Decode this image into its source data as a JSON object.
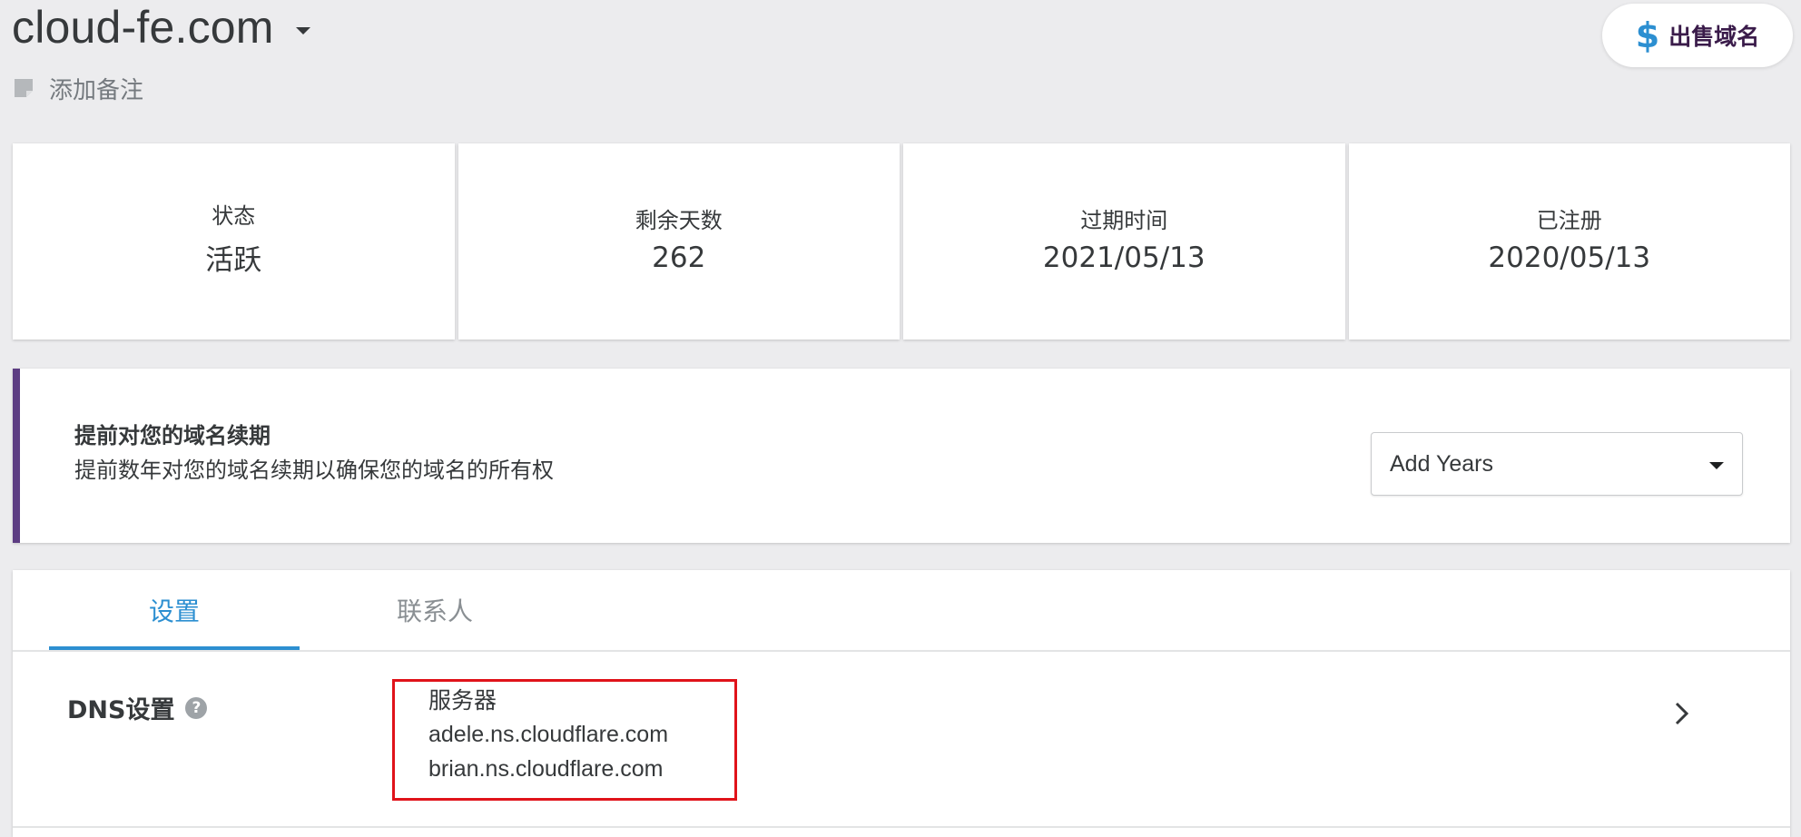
{
  "header": {
    "domain_name": "cloud-fe.com",
    "add_note_label": "添加备注",
    "sell_button": {
      "icon": "$",
      "label": "出售域名"
    }
  },
  "stats": [
    {
      "label": "状态",
      "value": "活跃"
    },
    {
      "label": "剩余天数",
      "value": "262"
    },
    {
      "label": "过期时间",
      "value": "2021/05/13"
    },
    {
      "label": "已注册",
      "value": "2020/05/13"
    }
  ],
  "renew": {
    "title": "提前对您的域名续期",
    "description": "提前数年对您的域名续期以确保您的域名的所有权",
    "select_value": "Add Years"
  },
  "tabs": [
    {
      "label": "设置",
      "active": true
    },
    {
      "label": "联系人",
      "active": false
    }
  ],
  "dns": {
    "label": "DNS设置",
    "help_icon": "?",
    "servers_heading": "服务器",
    "nameservers": [
      "adele.ns.cloudflare.com",
      "brian.ns.cloudflare.com"
    ]
  },
  "colors": {
    "background": "#ececee",
    "accent_blue": "#2c8fd1",
    "renew_border_purple": "#5c3c82",
    "highlight_red": "#e0131a",
    "sell_text": "#3a1b4a"
  },
  "icons": {
    "domain_dropdown": "chevron-down-icon",
    "note": "note-icon",
    "sell": "dollar-icon",
    "select_caret": "caret-down-icon",
    "help": "question-circle-icon",
    "row_arrow": "chevron-right-icon"
  }
}
